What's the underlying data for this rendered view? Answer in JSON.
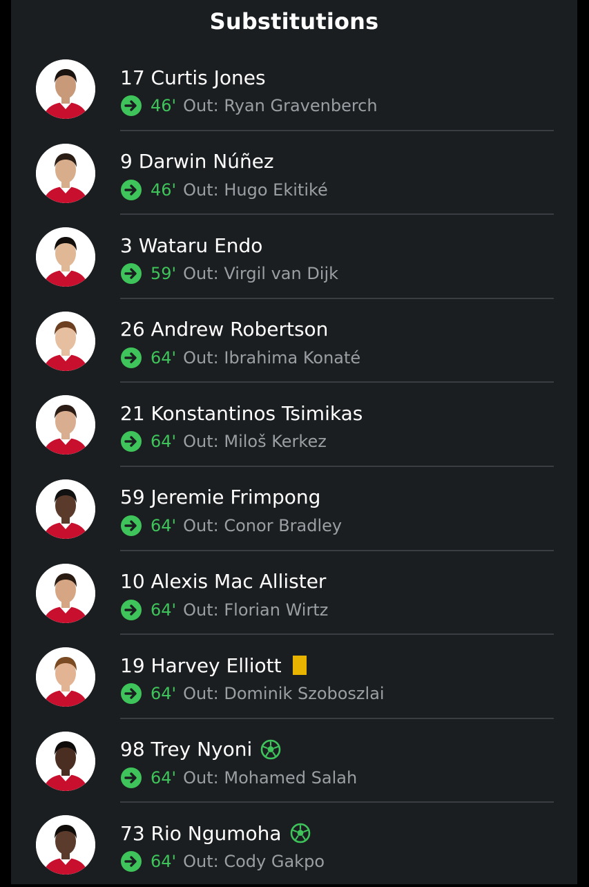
{
  "header": {
    "title": "Substitutions"
  },
  "colors": {
    "background": "#1b1e20",
    "accent_green": "#3ec45a",
    "muted_text": "#9a9fa3",
    "yellow_card": "#e8b400",
    "kit_red": "#c8102e"
  },
  "substitutions": [
    {
      "number": "17",
      "name": "Curtis Jones",
      "player": "17 Curtis Jones",
      "minute": "46'",
      "out": "Out: Ryan Gravenberch",
      "badge": null,
      "icon": "arrow-right-circle-icon"
    },
    {
      "number": "9",
      "name": "Darwin Núñez",
      "player": "9 Darwin Núñez",
      "minute": "46'",
      "out": "Out: Hugo Ekitiké",
      "badge": null,
      "icon": "arrow-right-circle-icon"
    },
    {
      "number": "3",
      "name": "Wataru Endo",
      "player": "3 Wataru Endo",
      "minute": "59'",
      "out": "Out: Virgil van Dijk",
      "badge": null,
      "icon": "arrow-right-circle-icon"
    },
    {
      "number": "26",
      "name": "Andrew Robertson",
      "player": "26 Andrew Robertson",
      "minute": "64'",
      "out": "Out: Ibrahima Konaté",
      "badge": null,
      "icon": "arrow-right-circle-icon"
    },
    {
      "number": "21",
      "name": "Konstantinos Tsimikas",
      "player": "21 Konstantinos Tsimikas",
      "minute": "64'",
      "out": "Out: Miloš Kerkez",
      "badge": null,
      "icon": "arrow-right-circle-icon"
    },
    {
      "number": "59",
      "name": "Jeremie Frimpong",
      "player": "59 Jeremie Frimpong",
      "minute": "64'",
      "out": "Out: Conor Bradley",
      "badge": null,
      "icon": "arrow-right-circle-icon"
    },
    {
      "number": "10",
      "name": "Alexis Mac Allister",
      "player": "10 Alexis Mac Allister",
      "minute": "64'",
      "out": "Out: Florian Wirtz",
      "badge": null,
      "icon": "arrow-right-circle-icon"
    },
    {
      "number": "19",
      "name": "Harvey Elliott",
      "player": "19 Harvey Elliott",
      "minute": "64'",
      "out": "Out: Dominik Szoboszlai",
      "badge": "yellow-card",
      "icon": "arrow-right-circle-icon"
    },
    {
      "number": "98",
      "name": "Trey Nyoni",
      "player": "98 Trey Nyoni",
      "minute": "64'",
      "out": "Out: Mohamed Salah",
      "badge": "goal",
      "icon": "arrow-right-circle-icon"
    },
    {
      "number": "73",
      "name": "Rio Ngumoha",
      "player": "73 Rio Ngumoha",
      "minute": "64'",
      "out": "Out: Cody Gakpo",
      "badge": "goal",
      "icon": "arrow-right-circle-icon"
    }
  ]
}
